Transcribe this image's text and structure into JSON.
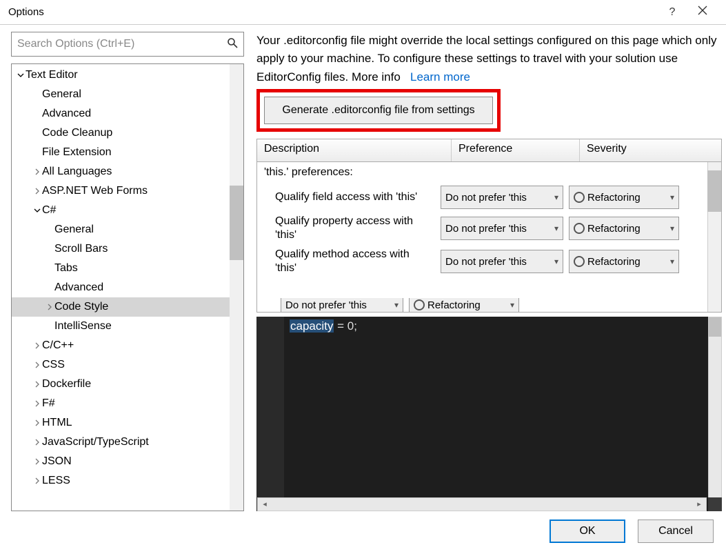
{
  "window": {
    "title": "Options"
  },
  "search": {
    "placeholder": "Search Options (Ctrl+E)"
  },
  "tree": {
    "root": "Text Editor",
    "gen": "General",
    "adv": "Advanced",
    "cleanup": "Code Cleanup",
    "ext": "File Extension",
    "alllang": "All Languages",
    "asp": "ASP.NET Web Forms",
    "csharp": "C#",
    "cs_gen": "General",
    "cs_scroll": "Scroll Bars",
    "cs_tabs": "Tabs",
    "cs_adv": "Advanced",
    "cs_style": "Code Style",
    "cs_int": "IntelliSense",
    "cpp": "C/C++",
    "css": "CSS",
    "docker": "Dockerfile",
    "fsharp": "F#",
    "html": "HTML",
    "jts": "JavaScript/TypeScript",
    "json": "JSON",
    "less": "LESS"
  },
  "intro": {
    "text": "Your .editorconfig file might override the local settings configured on this page which only apply to your machine. To configure these settings to travel with your solution use EditorConfig files. More info",
    "link": "Learn more"
  },
  "generate_btn": "Generate .editorconfig file from settings",
  "grid": {
    "col_desc": "Description",
    "col_pref": "Preference",
    "col_sev": "Severity",
    "group": "'this.' preferences:",
    "pref_value": "Do not prefer 'this",
    "sev_value": "Refactoring",
    "rows": [
      {
        "desc": "Qualify field access with 'this'"
      },
      {
        "desc": "Qualify property access with 'this'"
      },
      {
        "desc": "Qualify method access with 'this'"
      }
    ],
    "cutoff_pref": "Do not prefer 'this",
    "cutoff_sev": "Refactoring"
  },
  "code": {
    "token": "capacity",
    "rest": " = 0;"
  },
  "footer": {
    "ok": "OK",
    "cancel": "Cancel"
  }
}
